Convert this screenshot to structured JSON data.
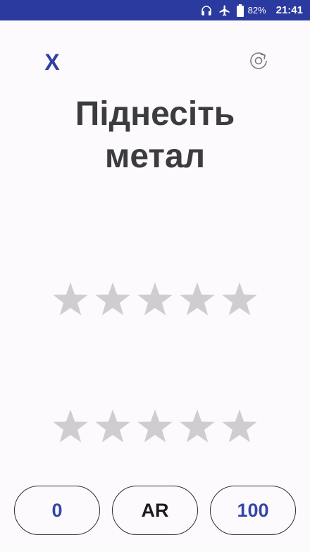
{
  "status_bar": {
    "battery_percent": "82%",
    "time": "21:41",
    "icons": [
      "headphones-icon",
      "airplane-mode-icon",
      "battery-icon"
    ]
  },
  "header": {
    "close_label": "X",
    "reset_icon": "rotate-icon"
  },
  "instruction": {
    "line1": "Піднесіть",
    "line2": "метал"
  },
  "ratings": {
    "top_row": {
      "stars_total": 5,
      "stars_filled": 0
    },
    "bottom_row": {
      "stars_total": 5,
      "stars_filled": 0
    },
    "star_color": "#cfcdd0"
  },
  "controls": {
    "min_label": "0",
    "ar_label": "AR",
    "max_label": "100"
  },
  "colors": {
    "status_bar": "#2b3a9e",
    "accent": "#3545a6",
    "background": "#fcfafd",
    "text": "#3b3b40"
  }
}
